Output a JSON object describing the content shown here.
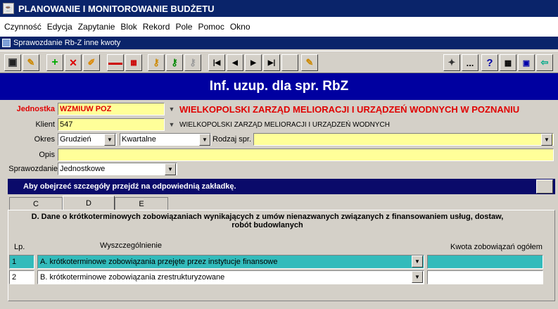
{
  "titlebar": {
    "title": "PLANOWANIE I MONITOROWANIE BUDŻETU"
  },
  "menu": [
    "Czynność",
    "Edycja",
    "Zapytanie",
    "Blok",
    "Rekord",
    "Pole",
    "Pomoc",
    "Okno"
  ],
  "subwindow": {
    "title": "Sprawozdanie Rb-Z inne kwoty"
  },
  "toolbar": {
    "buttons": [
      "save-icon",
      "exit-icon",
      "add-icon",
      "delete-icon",
      "clear-icon",
      "duplicate-icon",
      "export-icon",
      "query-icon",
      "query-exec-icon",
      "query-cancel-icon",
      "first-record-icon",
      "prev-record-icon",
      "next-record-icon",
      "last-record-icon",
      "edit-icon",
      "tools-icon",
      "list-icon",
      "help-icon",
      "calculator-icon",
      "calendar-icon",
      "logout-icon"
    ],
    "lov_label": "..."
  },
  "banner": {
    "title": "Inf. uzup. dla spr. RbZ"
  },
  "form": {
    "jednostka_label": "Jednostka",
    "jednostka_code": "WZMIUW POZ",
    "jednostka_name": "WIELKOPOLSKI ZARZĄD MELIORACJI I URZĄDZEŃ WODNYCH W POZNANIU",
    "klient_label": "Klient",
    "klient_code": "547",
    "klient_name": "WIELKOPOLSKI ZARZĄD MELIORACJI I URZĄDZEŃ WODNYCH",
    "okres_label": "Okres",
    "okres_value": "Grudzień",
    "okres_type": "Kwartalne",
    "rodzaj_label": "Rodzaj spr.",
    "rodzaj_value": "",
    "opis_label": "Opis",
    "opis_value": "",
    "sprawozdanie_label": "Sprawozdanie",
    "sprawozdanie_value": "Jednostkowe"
  },
  "info": {
    "text": "Aby obejrzeć szczegóły przejdź na odpowiednią zakładkę."
  },
  "tabs": [
    "C",
    "D",
    "E"
  ],
  "section": {
    "title": "D. Dane o krótkoterminowych zobowiązaniach wynikających z umów nienazwanych związanych z finansowaniem usług, dostaw, robót budowlanych",
    "col_lp": "Lp.",
    "col_desc": "Wyszczególnienie",
    "col_amount": "Kwota zobowiązań ogółem",
    "rows": [
      {
        "lp": "1",
        "desc": "A. krótkoterminowe zobowiązania przejęte przez instytucje finansowe",
        "amount": ""
      },
      {
        "lp": "2",
        "desc": "B. krótkoterminowe zobowiązania zrestrukturyzowane",
        "amount": ""
      }
    ]
  },
  "colors": {
    "title_bg": "#0a246a",
    "banner_bg": "#0000a0",
    "field_bg": "#ffff99",
    "selected_row": "#33bbbb",
    "accent_red": "#e00000"
  }
}
